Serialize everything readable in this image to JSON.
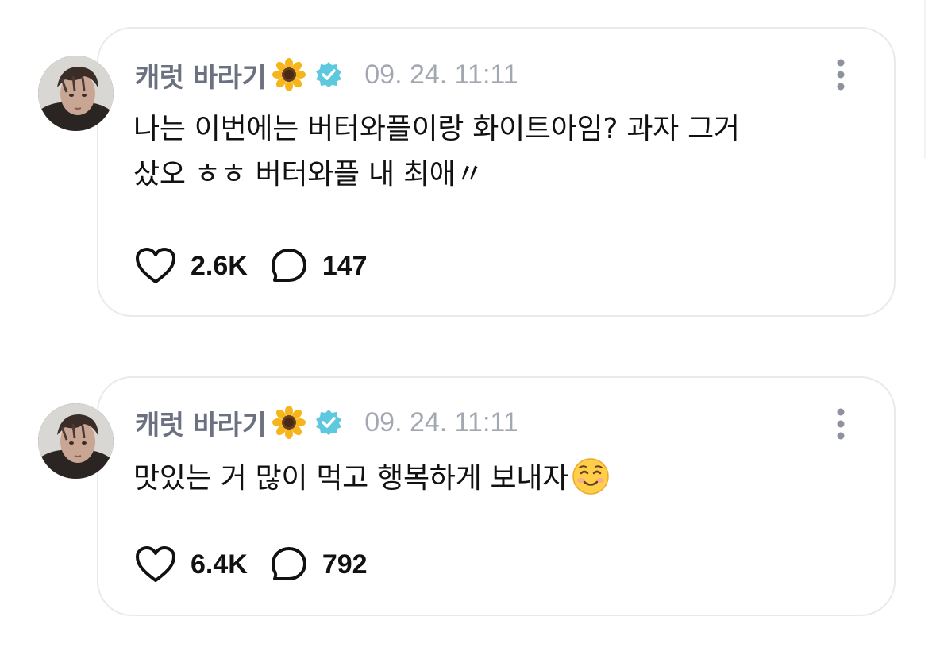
{
  "posts": [
    {
      "author": "캐럿 바라기",
      "author_emoji": "sunflower",
      "verified": true,
      "timestamp": "09. 24. 11:11",
      "text_line1": "나는 이번에는 버터와플이랑 화이트아임? 과자 그거",
      "text_line2": "샀오 ㅎㅎ 버터와플 내 최애〃",
      "likes": "2.6K",
      "comments": "147"
    },
    {
      "author": "캐럿 바라기",
      "author_emoji": "sunflower",
      "verified": true,
      "timestamp": "09. 24. 11:11",
      "text_line1": "맛있는 거 많이 먹고 행복하게 보내자",
      "text_emoji": "smiling-face-emoji",
      "likes": "6.4K",
      "comments": "792"
    }
  ],
  "icons": {
    "heart": "heart-outline-icon",
    "comment": "speech-bubble-icon",
    "more": "vertical-ellipsis-icon",
    "verified": "verified-check-icon"
  },
  "colors": {
    "author": "#6b7180",
    "timestamp": "#a3a7b1",
    "verified": "#5ec8de",
    "text": "#111111",
    "card_border": "#e9e9ee"
  }
}
